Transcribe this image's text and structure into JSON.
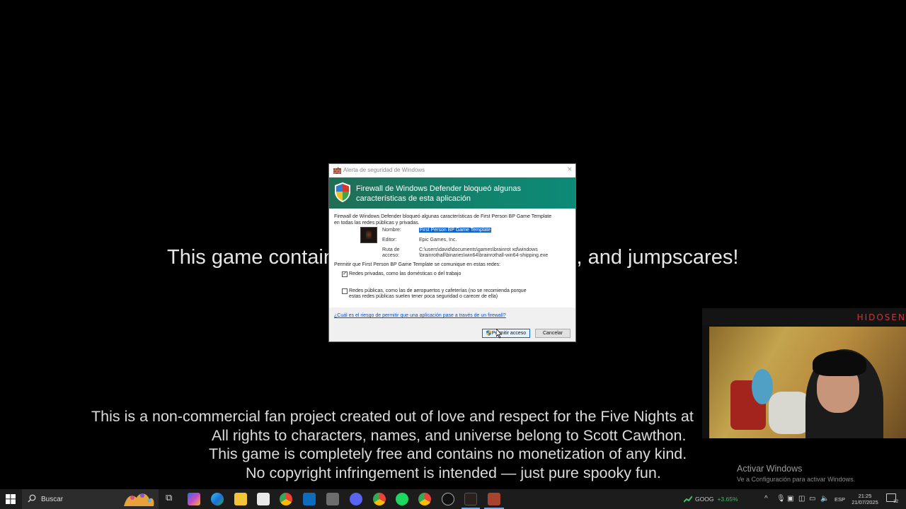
{
  "game": {
    "warning_left": "This game contain",
    "warning_right": "s, and jumpscares!",
    "disclaimer": [
      "This is a non-commercial fan project created out of love and respect for the Five Nights at",
      "All rights to characters, names, and universe belong to Scott Cawthon.",
      "This game is completely free and contains no monetization of any kind.",
      "No copyright infringement is intended — just pure spooky fun."
    ]
  },
  "dialog": {
    "title": "Alerta de seguridad de Windows",
    "heading_line1": "Firewall de Windows Defender bloqueó algunas",
    "heading_line2": "características de esta aplicación",
    "intro_line1": "Firewall de Windows Defender bloqueó algunas características de First Person BP Game Template",
    "intro_line2": "en todas las redes públicas y privadas.",
    "name_label": "Nombre:",
    "name_value": "First Person BP Game Template",
    "publisher_label": "Editor:",
    "publisher_value": "Epic Games, Inc.",
    "path_label_1": "Ruta de",
    "path_label_2": "acceso:",
    "path_value_1": "C:\\users\\david\\documents\\games\\brainrot xd\\windows",
    "path_value_2": "\\brainrothall\\binaries\\win64\\brainrothall-win64-shipping.exe",
    "allow_text": "Permitir que First Person BP Game Template se comunique en estas redes:",
    "private_checked": true,
    "private_label": "Redes privadas, como las domésticas o del trabajo",
    "public_checked": false,
    "public_label_1": "Redes públicas, como las de aeropuertos y cafeterías (no se recomienda porque",
    "public_label_2": "estas redes públicas suelen tener poca seguridad o carecer de ella)",
    "risk_link": "¿Cuál es el riesgo de permitir que una aplicación pase a través de un firewall?",
    "allow_button": "Permitir acceso",
    "cancel_button": "Cancelar",
    "close_glyph": "×"
  },
  "webcam": {
    "brand": "HIDOSEN"
  },
  "watermark": {
    "title": "Activar Windows",
    "subtitle": "Ve a Configuración para activar Windows."
  },
  "taskbar": {
    "search_placeholder": "Buscar",
    "stock_ticker": "GOOG",
    "stock_change": "+3.65%",
    "language": "ESP",
    "time": "21:25",
    "date": "21/07/2025",
    "notification_count": "12",
    "colors": {
      "accent_teal": "#12836d",
      "link_blue": "#0a4fc4",
      "stock_green": "#3fbf6a"
    }
  }
}
